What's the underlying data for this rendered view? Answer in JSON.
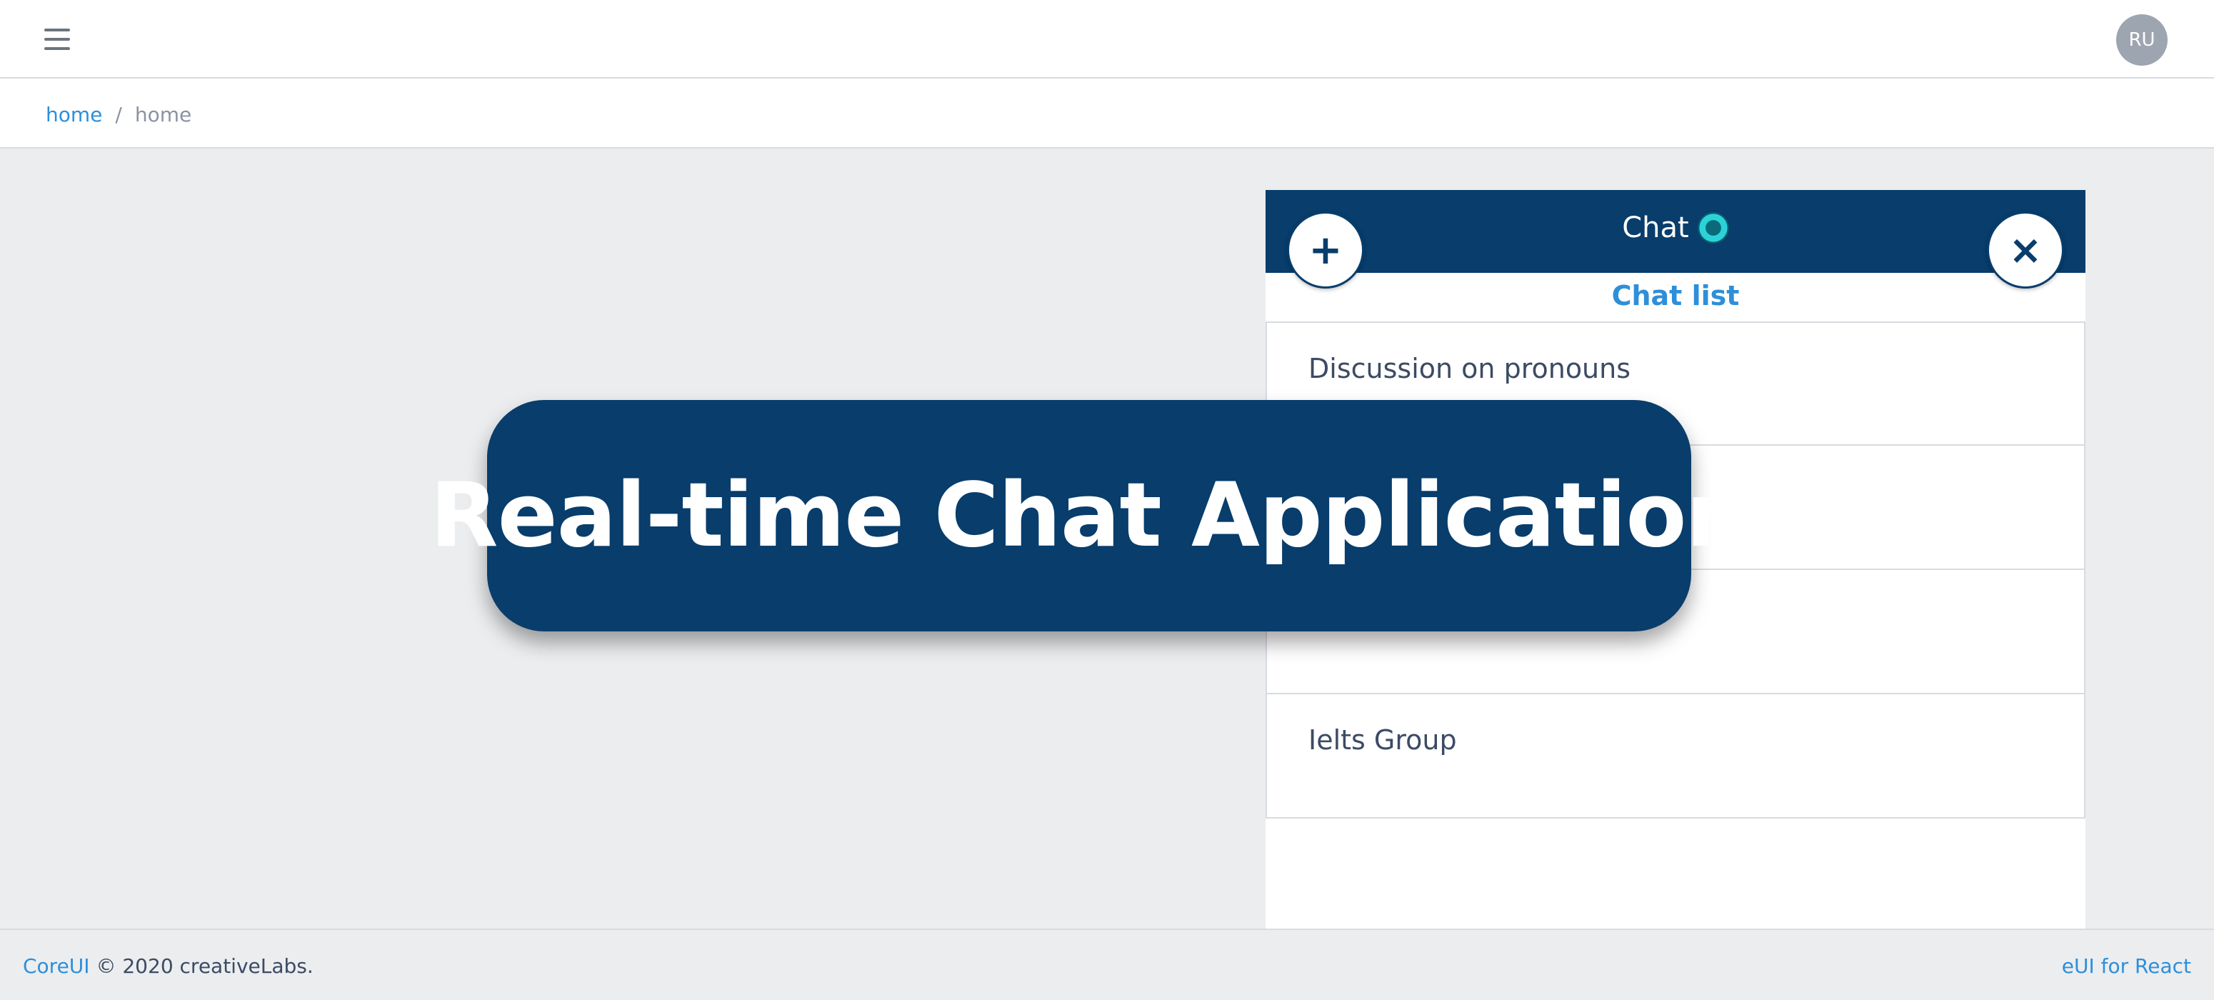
{
  "header": {
    "menu_icon": "hamburger-icon",
    "avatar_initials": "RU"
  },
  "breadcrumb": {
    "link": "home",
    "separator": "/",
    "current": "home"
  },
  "chat": {
    "title": "Chat",
    "status_color": "#2bd3d8",
    "add_icon": "+",
    "close_icon": "×",
    "subtitle": "Chat list",
    "items": [
      {
        "name": "Discussion on pronouns"
      },
      {
        "name": ""
      },
      {
        "name": ""
      },
      {
        "name": "Ielts Group"
      }
    ]
  },
  "banner": {
    "text": "Real-time Chat Application"
  },
  "footer": {
    "brand_link": "CoreUI",
    "copyright": "© 2020 creativeLabs.",
    "right_text": "eUI for React"
  },
  "colors": {
    "header_navy": "#083d6c",
    "link_blue": "#2e8fd9",
    "background": "#ebedef"
  }
}
